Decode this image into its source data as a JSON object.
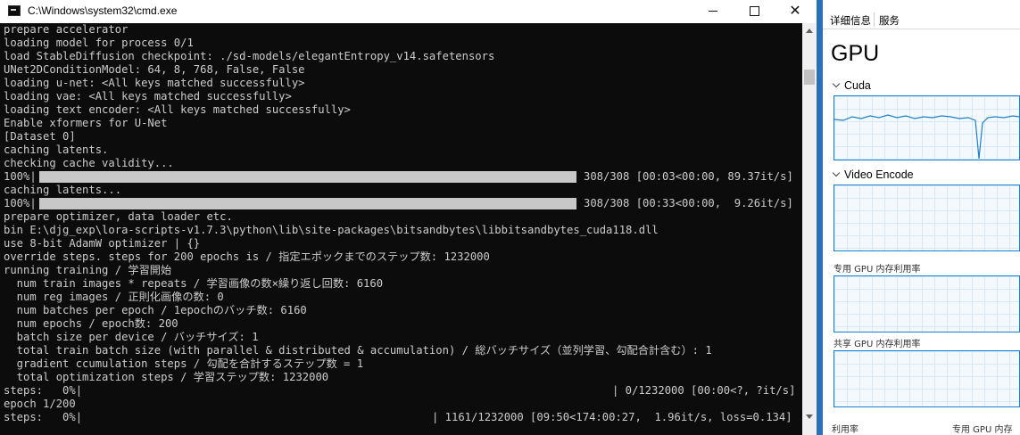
{
  "window": {
    "title": "C:\\Windows\\system32\\cmd.exe",
    "minimize": "minimize",
    "maximize": "maximize",
    "close": "close"
  },
  "console": {
    "lines": [
      "prepare accelerator",
      "loading model for process 0/1",
      "load StableDiffusion checkpoint: ./sd-models/elegantEntropy_v14.safetensors",
      "UNet2DConditionModel: 64, 8, 768, False, False",
      "loading u-net: <All keys matched successfully>",
      "loading vae: <All keys matched successfully>",
      "loading text encoder: <All keys matched successfully>",
      "Enable xformers for U-Net",
      "[Dataset 0]",
      "caching latents.",
      "checking cache validity...",
      "100%|",
      "caching latents...",
      "100%|",
      "prepare optimizer, data loader etc.",
      "bin E:\\djg_exp\\lora-scripts-v1.7.3\\python\\lib\\site-packages\\bitsandbytes\\libbitsandbytes_cuda118.dll",
      "use 8-bit AdamW optimizer | {}",
      "override steps. steps for 200 epochs is / 指定エポックまでのステップ数: 1232000",
      "running training / 学習開始",
      "  num train images * repeats / 学習画像の数×繰り返し回数: 6160",
      "  num reg images / 正則化画像の数: 0",
      "  num batches per epoch / 1epochのバッチ数: 6160",
      "  num epochs / epoch数: 200",
      "  batch size per device / バッチサイズ: 1",
      "  total train batch size (with parallel & distributed & accumulation) / 総バッチサイズ（並列学習、勾配合計含む）: 1",
      "  gradient ccumulation steps / 勾配を合計するステップ数 = 1",
      "  total optimization steps / 学習ステップ数: 1232000",
      "steps:   0%|",
      "epoch 1/200",
      "steps:   0%|"
    ],
    "progress": [
      {
        "fraction": 1.0,
        "status": "308/308 [00:03<00:00, 89.37it/s]"
      },
      {
        "fraction": 1.0,
        "status": "308/308 [00:33<00:00,  9.26it/s]"
      }
    ],
    "steps_status_1": "| 0/1232000 [00:00<?, ?it/s]",
    "steps_status_2": "| 1161/1232000 [09:50<174:00:27,  1.96it/s, loss=0.134]"
  },
  "taskmgr": {
    "tab_details": "详细信息",
    "tab_services": "服务",
    "heading": "GPU",
    "section_cuda": "Cuda",
    "section_video_encode": "Video Encode",
    "label_dedicated": "专用 GPU 内存利用率",
    "label_shared": "共享 GPU 内存利用率",
    "label_utilization": "利用率",
    "label_dedicated_bottom": "专用 GPU 内存"
  },
  "colors": {
    "console_bg": "#0c0c0c",
    "console_text": "#cccccc",
    "graph_border": "#1a7fd0",
    "graph_line": "#1e7fc8"
  }
}
